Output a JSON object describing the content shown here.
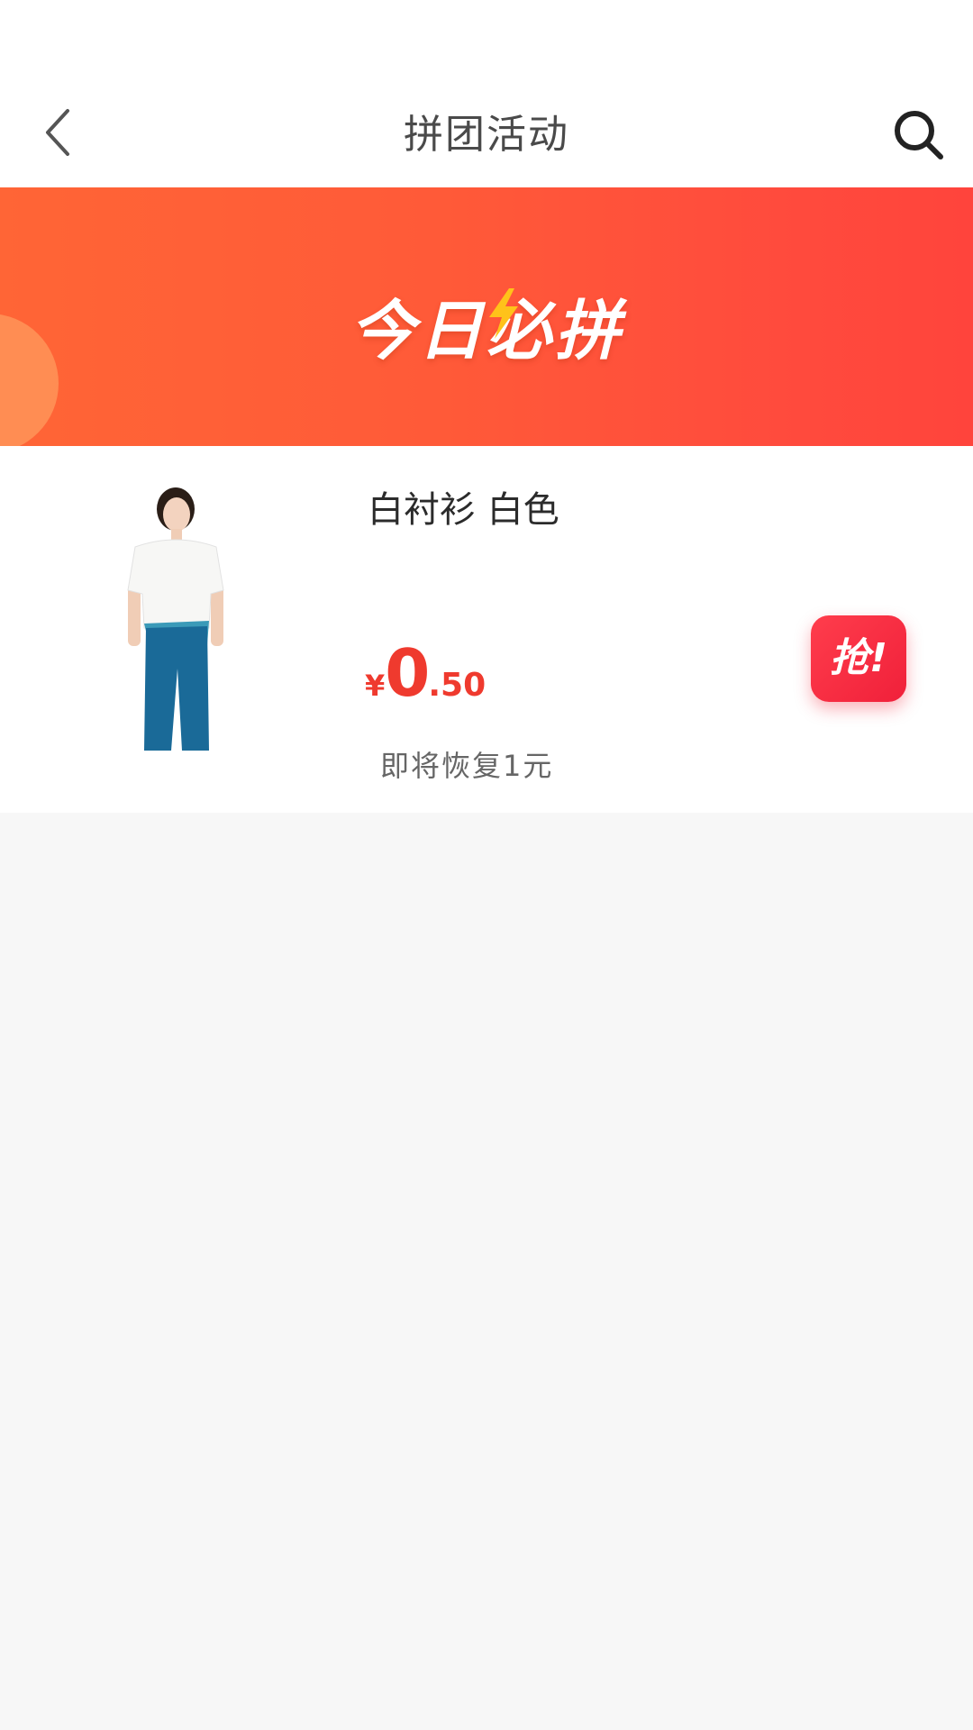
{
  "header": {
    "title": "拼团活动",
    "back_icon": "chevron-left-icon",
    "search_icon": "search-icon"
  },
  "banner": {
    "title": "今日必拼",
    "icon": "bolt-icon"
  },
  "product": {
    "name": "白衬衫 白色",
    "price_symbol": "¥",
    "price_integer": "0",
    "price_decimal": ".50",
    "restore_note": "即将恢复1元",
    "grab_label": "抢!"
  },
  "colors": {
    "banner_start": "#ff6536",
    "banner_end": "#ff443c",
    "price": "#ef3a2e",
    "grab_button": "#f0203a",
    "page_background": "#f7f7f7"
  }
}
